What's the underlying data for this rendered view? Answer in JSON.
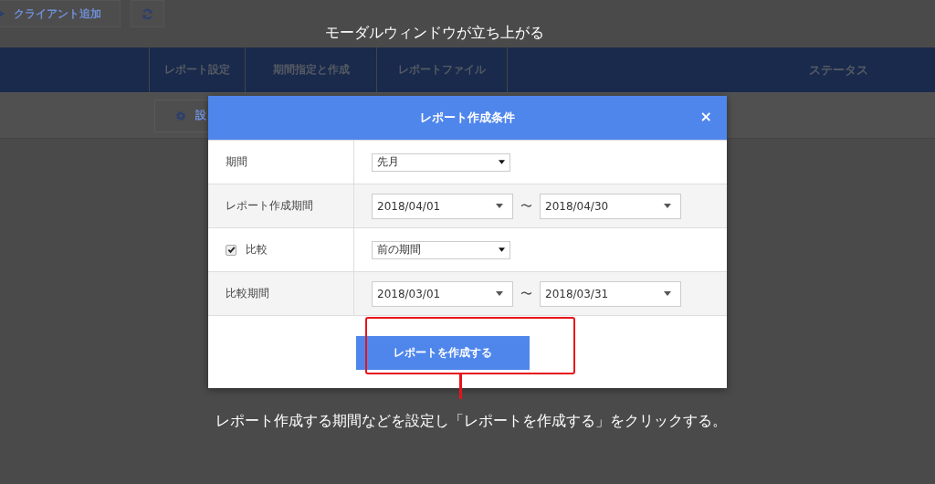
{
  "toolbar": {
    "add_button": "クライアント追加"
  },
  "tabs": [
    {
      "label": "レポート設定"
    },
    {
      "label": "期間指定と作成"
    },
    {
      "label": "レポートファイル"
    }
  ],
  "status_header": "ステータス",
  "settings_button": "設",
  "modal": {
    "title": "レポート作成条件",
    "close": "×",
    "rows": [
      {
        "kind": "select",
        "label": "期間",
        "value": "先月"
      },
      {
        "kind": "range",
        "label": "レポート作成期間",
        "from": "2018/04/01",
        "separator": "〜",
        "to": "2018/04/30"
      },
      {
        "kind": "check_select",
        "label": "比較",
        "checked": true,
        "value": "前の期間"
      },
      {
        "kind": "range",
        "label": "比較期間",
        "from": "2018/03/01",
        "separator": "〜",
        "to": "2018/03/31"
      }
    ],
    "submit": "レポートを作成する"
  },
  "annotations": {
    "top": "モーダルウィンドウが立ち上がる",
    "bottom": "レポート作成する期間などを設定し「レポートを作成する」をクリックする。"
  }
}
